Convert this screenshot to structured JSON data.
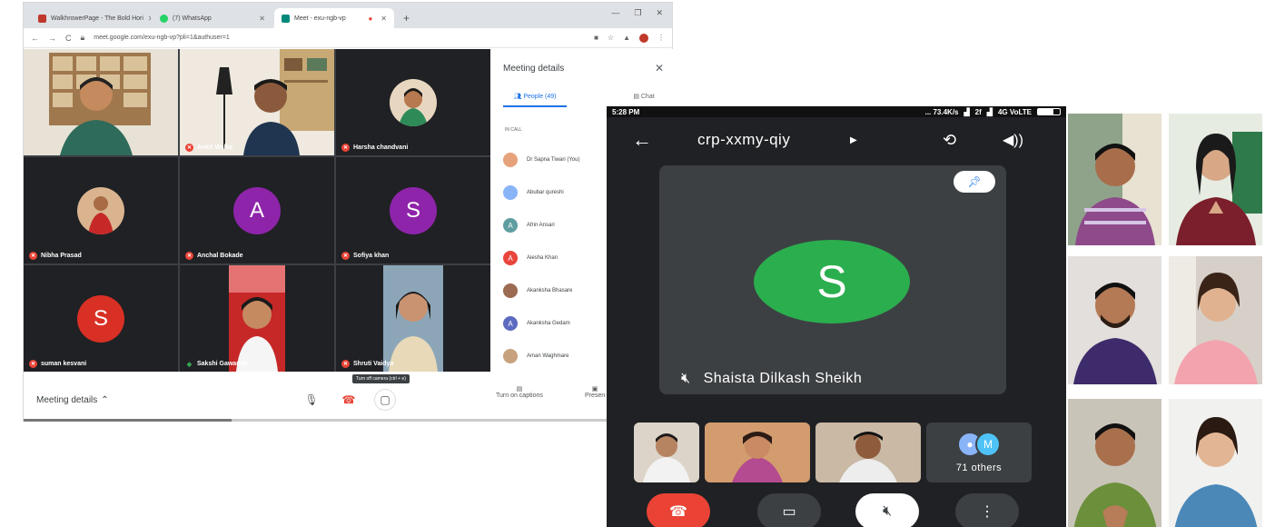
{
  "browser": {
    "tabs": [
      {
        "label": "WalkhrowerPage - The Bold Hori",
        "color": "#c0392b"
      },
      {
        "label": "(7) WhatsApp",
        "color": "#25d366"
      },
      {
        "label": "Meet - exu-ngb-vp",
        "color": "#00897b"
      }
    ],
    "url": "meet.google.com/exu-ngb-vp?pli=1&authuser=1"
  },
  "meet": {
    "tiles": [
      {
        "name": "",
        "mic": "off",
        "kind": "video",
        "bg": "#b98d5b"
      },
      {
        "name": "Ankit Walke",
        "mic": "off",
        "kind": "video",
        "bg": "#e4d6c2"
      },
      {
        "name": "Harsha chandvani",
        "mic": "off",
        "kind": "photo",
        "bg": "#f0c7a0"
      },
      {
        "name": "Nibha Prasad",
        "mic": "off",
        "kind": "photo",
        "bg": "#c9603f"
      },
      {
        "name": "Anchal Bokade",
        "mic": "off",
        "kind": "letter",
        "letter": "A",
        "bg": "#8e24aa"
      },
      {
        "name": "Sofiya khan",
        "mic": "off",
        "kind": "letter",
        "letter": "S",
        "bg": "#8e24aa"
      },
      {
        "name": "suman kesvani",
        "mic": "off",
        "kind": "letter",
        "letter": "S",
        "bg": "#d93025"
      },
      {
        "name": "Sakshi Gawande",
        "mic": "on",
        "kind": "video-small",
        "bg": "#c62828"
      },
      {
        "name": "Shruti Vaidya",
        "mic": "off",
        "kind": "video-small",
        "bg": "#8ca6b8"
      }
    ],
    "bottom": {
      "details_label": "Meeting details",
      "tooltip": "Turn off camera (ctrl + e)",
      "captions_label": "Turn on captions",
      "present_label": "Presen"
    },
    "panel": {
      "title": "Meeting details",
      "people_tab": "People (49)",
      "chat_tab": "Chat",
      "section": "IN CALL",
      "people": [
        {
          "name": "Dr Sapna Tiwari (You)",
          "color": "#e6a27a",
          "letter": ""
        },
        {
          "name": "Abubar qureshi",
          "color": "#8ab4f8",
          "letter": ""
        },
        {
          "name": "Afrin Ansari",
          "color": "#5f9ea0",
          "letter": "A"
        },
        {
          "name": "Aiesha Khan",
          "color": "#e8453c",
          "letter": "A"
        },
        {
          "name": "Akanksha Bhasare",
          "color": "#9b6b52",
          "letter": ""
        },
        {
          "name": "Akanksha Gedam",
          "color": "#5c6bc0",
          "letter": "A"
        },
        {
          "name": "Aman Waghmare",
          "color": "#c8a27e",
          "letter": ""
        }
      ]
    }
  },
  "phone": {
    "time": "5:28 PM",
    "status_right": "... 73.4K/s",
    "signal": "2f",
    "network": "4G VoLTE",
    "meeting_code": "crp-xxmy-qiy",
    "main": {
      "letter": "S",
      "name": "Shaista Dilkash Sheikh",
      "avatar_color": "#2bae4e"
    },
    "others_label": "71 others",
    "others_letter": "M"
  },
  "icons": {
    "back": "back-arrow-icon",
    "rotate": "switch-camera-icon",
    "speaker": "speaker-icon",
    "pin": "pin-icon",
    "mic_off": "mic-off-icon",
    "end_call": "end-call-icon",
    "camera": "camera-icon",
    "more": "more-vert-icon"
  },
  "colors": {
    "end_call": "#ea4335",
    "meet_bg": "#202124",
    "accent": "#1a73e8"
  }
}
